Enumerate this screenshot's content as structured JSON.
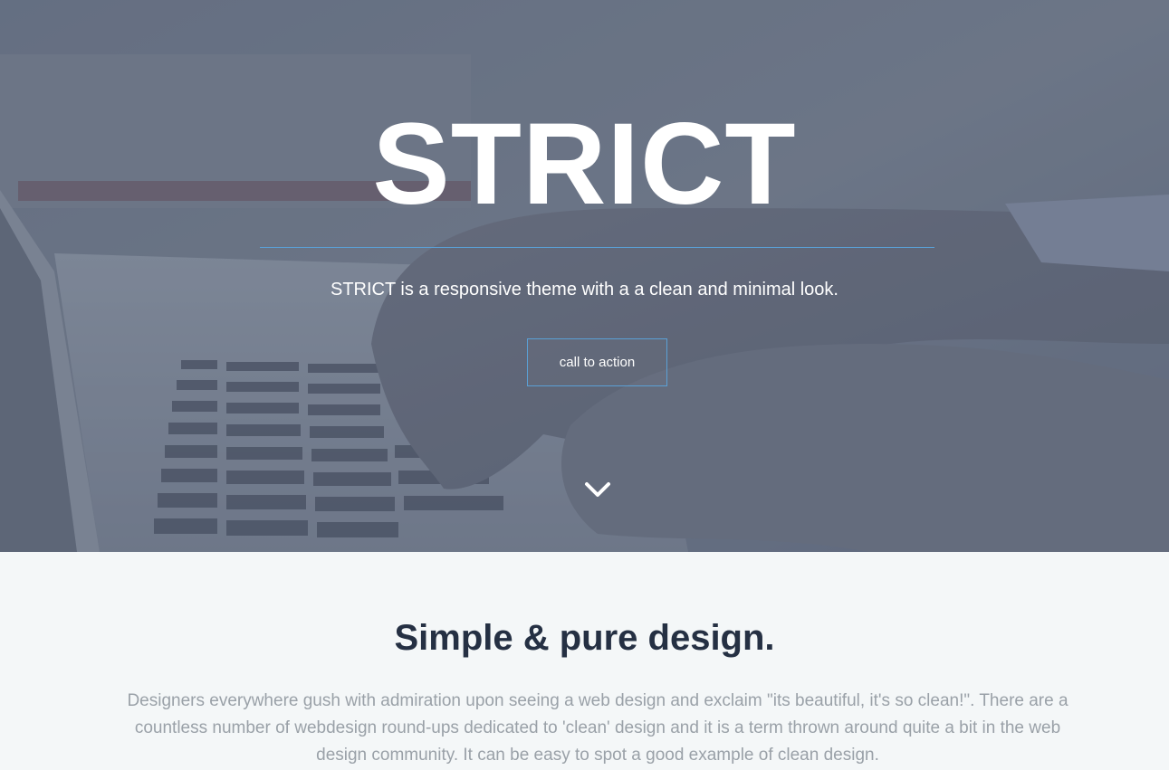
{
  "hero": {
    "title": "STRICT",
    "tagline": "STRICT is a responsive theme with a a clean and minimal look.",
    "cta_label": "call to action",
    "scroll_icon": "chevron-down-icon",
    "accent_color": "#5aa0d6"
  },
  "intro": {
    "heading": "Simple & pure design.",
    "body": "Designers everywhere gush with admiration upon seeing a web design and exclaim \"its beautiful, it's so clean!\". There are a countless number of webdesign round-ups dedicated to 'clean' design and it is a term thrown around quite a bit in the web design community. It can be easy to spot a good example of clean design."
  }
}
